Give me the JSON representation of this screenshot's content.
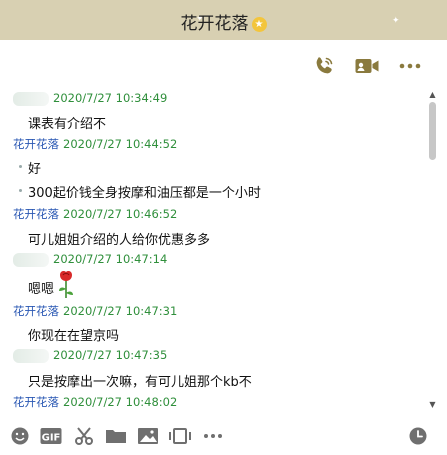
{
  "window": {
    "title": "花开花落"
  },
  "colors": {
    "title_bar": "#d8d0b2",
    "sender_name": "#2957b3",
    "timestamp": "#2f8f3b",
    "icon": "#8a7a3e"
  },
  "header_actions": [
    {
      "icon": "phone-icon"
    },
    {
      "icon": "video-call-icon"
    },
    {
      "icon": "more-icon"
    }
  ],
  "messages": [
    {
      "sender": "",
      "time": "2020/7/27 10:34:49",
      "lines": [
        "课表有介绍不"
      ]
    },
    {
      "sender": "花开花落",
      "time": "2020/7/27 10:44:52",
      "lines": [
        "好",
        "300起价钱全身按摩和油压都是一个小时"
      ]
    },
    {
      "sender": "花开花落",
      "time": "2020/7/27 10:46:52",
      "lines": [
        "可儿姐姐介绍的人给你优惠多多"
      ]
    },
    {
      "sender": "",
      "time": "2020/7/27 10:47:14",
      "lines": [
        "嗯嗯"
      ]
    },
    {
      "sender": "花开花落",
      "time": "2020/7/27 10:47:31",
      "lines": [
        "你现在在望京吗"
      ]
    },
    {
      "sender": "",
      "time": "2020/7/27 10:47:35",
      "lines": [
        "只是按摩出一次嘛，有可儿姐那个kb不"
      ]
    },
    {
      "sender": "花开花落",
      "time": "2020/7/27 10:48:02",
      "lines": []
    }
  ],
  "toolbar": {
    "gif_label": "GIF",
    "icons": [
      "emoji-icon",
      "gif-icon",
      "scissors-icon",
      "folder-icon",
      "image-icon",
      "screen-record-icon",
      "more-icon",
      "history-clock-icon"
    ]
  }
}
